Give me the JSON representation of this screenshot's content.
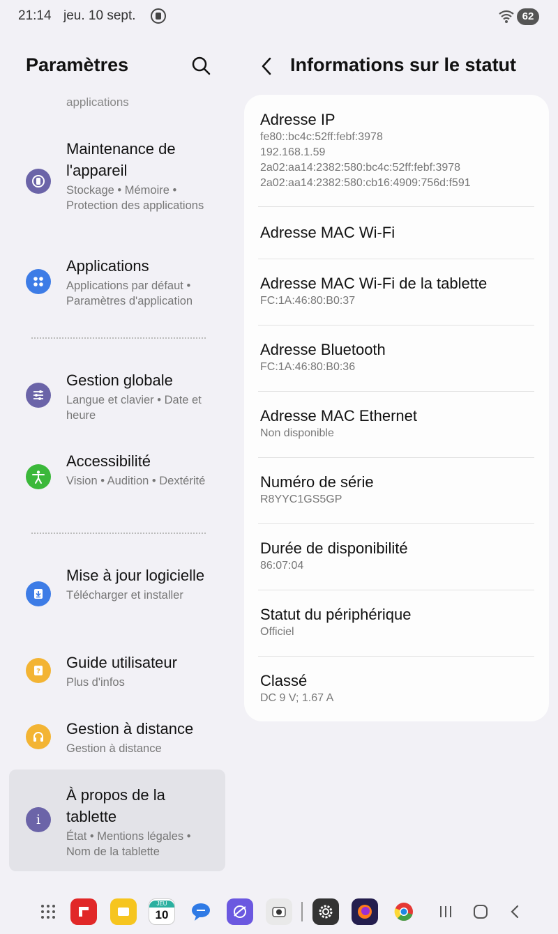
{
  "status_bar": {
    "time": "21:14",
    "date": "jeu. 10 sept.",
    "battery": "62"
  },
  "left_pane": {
    "title": "Paramètres",
    "scrolled_subtitle": "applications",
    "items": [
      {
        "title": "Maintenance de l'appareil",
        "subtitle": "Stockage • Mémoire • Protection des applications",
        "icon": "device-care-icon",
        "color": "#6b64a8"
      },
      {
        "title": "Applications",
        "subtitle": "Applications par défaut • Paramètres d'application",
        "icon": "apps-icon",
        "color": "#3d7ce6"
      },
      {
        "title": "Gestion globale",
        "subtitle": "Langue et clavier • Date et heure",
        "icon": "sliders-icon",
        "color": "#6b64a8"
      },
      {
        "title": "Accessibilité",
        "subtitle": "Vision • Audition • Dextérité",
        "icon": "accessibility-icon",
        "color": "#3bb83a"
      },
      {
        "title": "Mise à jour logicielle",
        "subtitle": "Télécharger et installer",
        "icon": "software-update-icon",
        "color": "#3d7ce6"
      },
      {
        "title": "Guide utilisateur",
        "subtitle": "Plus d'infos",
        "icon": "user-guide-icon",
        "color": "#f3b433"
      },
      {
        "title": "Gestion à distance",
        "subtitle": "Gestion à distance",
        "icon": "headset-icon",
        "color": "#f3b433"
      },
      {
        "title": "À propos de la tablette",
        "subtitle": "État • Mentions légales • Nom de la tablette",
        "icon": "info-icon",
        "color": "#6b64a8"
      }
    ]
  },
  "right_pane": {
    "title": "Informations sur le statut",
    "rows": [
      {
        "title": "Adresse IP",
        "values": [
          "fe80::bc4c:52ff:febf:3978",
          "192.168.1.59",
          "2a02:aa14:2382:580:bc4c:52ff:febf:3978",
          "2a02:aa14:2382:580:cb16:4909:756d:f591"
        ]
      },
      {
        "title": "Adresse MAC Wi-Fi",
        "values": []
      },
      {
        "title": "Adresse MAC Wi-Fi de la tablette",
        "values": [
          "FC:1A:46:80:B0:37"
        ]
      },
      {
        "title": "Adresse Bluetooth",
        "values": [
          "FC:1A:46:80:B0:36"
        ]
      },
      {
        "title": "Adresse MAC Ethernet",
        "values": [
          "Non disponible"
        ]
      },
      {
        "title": "Numéro de série",
        "values": [
          "R8YYC1GS5GP"
        ]
      },
      {
        "title": "Durée de disponibilité",
        "values": [
          "86:07:04"
        ]
      },
      {
        "title": "Statut du périphérique",
        "values": [
          "Officiel"
        ]
      },
      {
        "title": "Classé",
        "values": [
          "DC 9 V; 1.67 A"
        ]
      }
    ]
  },
  "dock": {
    "calendar_day_label": "JEU",
    "calendar_day_number": "10",
    "apps": [
      "app-grid-icon",
      "flipboard-icon",
      "notes-icon",
      "calendar-icon",
      "messages-icon",
      "internet-icon",
      "camera-icon",
      "settings-icon",
      "firefox-icon",
      "chrome-icon"
    ]
  }
}
